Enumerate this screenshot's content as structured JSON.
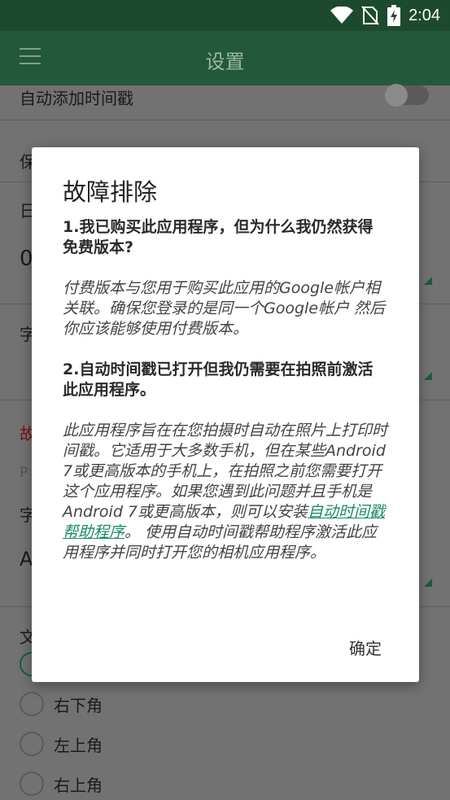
{
  "status_bar": {
    "time": "2:04",
    "icons": [
      "wifi-icon",
      "no-sim-icon",
      "battery-charging-icon"
    ]
  },
  "toolbar": {
    "title": "设置",
    "menu_icon": "hamburger-menu-icon"
  },
  "settings": {
    "auto_timestamp_label": "自动添加时间戳",
    "partial_rows": [
      "保",
      "日",
      "0",
      "字",
      "故",
      "P",
      "字",
      "A",
      "文"
    ],
    "position_options": [
      "右下角",
      "左上角",
      "右上角"
    ]
  },
  "dialog": {
    "title": "故障排除",
    "q1": "1.我已购买此应用程序，但为什么我仍然获得免费版本?",
    "a1": "付费版本与您用于购买此应用的Google帐户相关联。确保您登录的是同一个Google帐户 然后你应该能够使用付费版本。",
    "q2": "2.自动时间戳已打开但我仍需要在拍照前激活此应用程序。",
    "a2_before": "此应用程序旨在在您拍摄时自动在照片上打印时间戳。它适用于大多数手机，但在某些Android 7或更高版本的手机上，在拍照之前您需要打开 这个应用程序。如果您遇到此问题并且手机是Android 7或更高版本，则可以安装",
    "a2_link": "自动时间戳帮助程序",
    "a2_after": "。 使用自动时间戳帮助程序激活此应用程序并同时打开您的相机应用程序。",
    "ok_label": "确定"
  }
}
